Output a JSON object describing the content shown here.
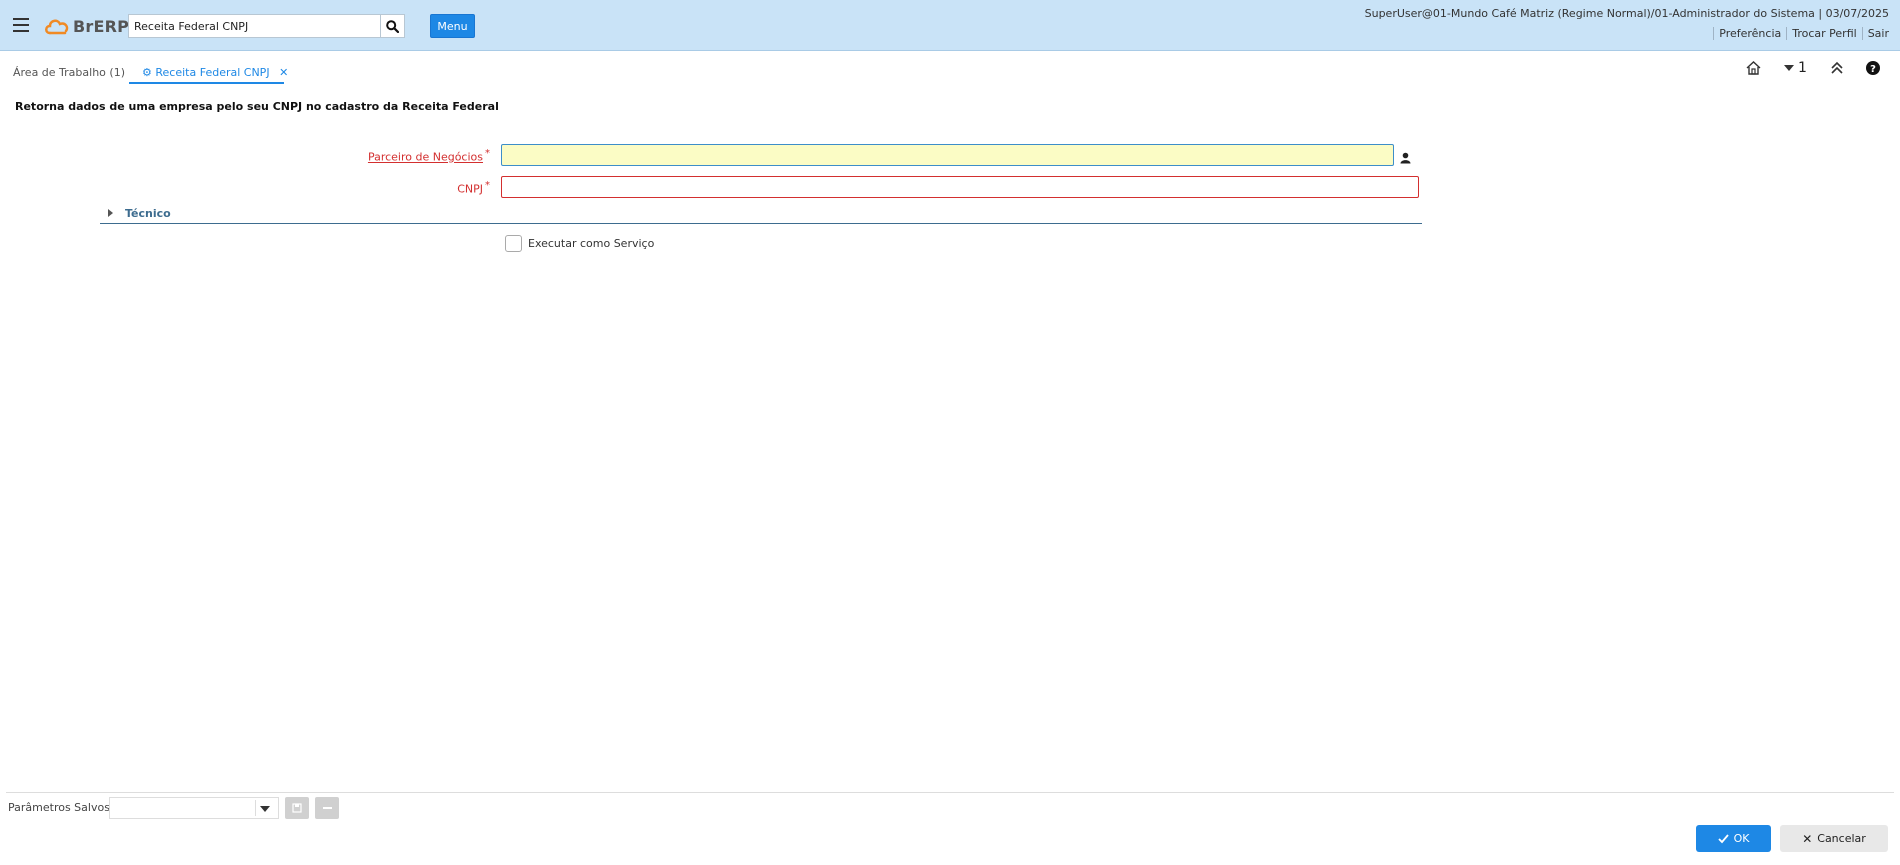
{
  "header": {
    "logo_text": "BrERP",
    "search_value": "Receita Federal CNPJ",
    "menu_label": "Menu",
    "user_info": "SuperUser@01-Mundo Café Matriz (Regime Normal)/01-Administrador do Sistema | 03/07/2025",
    "links": [
      "Preferência",
      "Trocar Perfil",
      "Sair"
    ]
  },
  "tabs": [
    {
      "label": "Área de Trabalho (1)"
    },
    {
      "label": "Receita Federal CNPJ"
    }
  ],
  "toolbar": {
    "window_count": "1"
  },
  "process": {
    "description": "Retorna dados de uma empresa pelo seu CNPJ no cadastro da Receita Federal",
    "fields": [
      {
        "label": "Parceiro de Negócios",
        "value": ""
      },
      {
        "label": "CNPJ",
        "value": ""
      }
    ],
    "required_mark": "*",
    "section_title": "Técnico",
    "run_as_service_label": "Executar como Serviço"
  },
  "footer": {
    "saved_params_label": "Parâmetros Salvos",
    "ok_label": "OK",
    "cancel_label": "Cancelar"
  },
  "colors": {
    "header_bg": "#c9e3f7",
    "accent": "#1e88e5",
    "required": "#d32f2f",
    "section": "#3d6c8f"
  }
}
